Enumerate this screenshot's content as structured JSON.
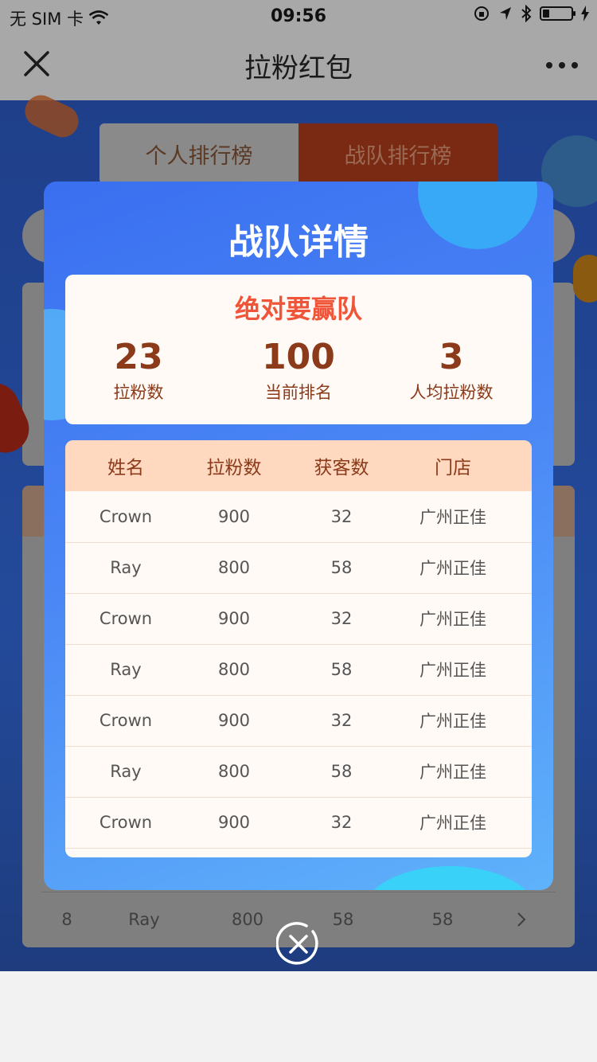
{
  "status_bar": {
    "carrier": "无 SIM 卡",
    "time": "09:56"
  },
  "nav": {
    "title": "拉粉红包"
  },
  "background": {
    "tabs": [
      "个人排行榜",
      "战队排行榜"
    ],
    "last_row": [
      "8",
      "Ray",
      "800",
      "58",
      "58"
    ]
  },
  "modal": {
    "title": "战队详情",
    "team_name": "绝对要赢队",
    "stats": [
      {
        "value": "23",
        "label": "拉粉数"
      },
      {
        "value": "100",
        "label": "当前排名"
      },
      {
        "value": "3",
        "label": "人均拉粉数"
      }
    ],
    "table": {
      "headers": [
        "姓名",
        "拉粉数",
        "获客数",
        "门店"
      ],
      "rows": [
        [
          "Crown",
          "900",
          "32",
          "广州正佳"
        ],
        [
          "Ray",
          "800",
          "58",
          "广州正佳"
        ],
        [
          "Crown",
          "900",
          "32",
          "广州正佳"
        ],
        [
          "Ray",
          "800",
          "58",
          "广州正佳"
        ],
        [
          "Crown",
          "900",
          "32",
          "广州正佳"
        ],
        [
          "Ray",
          "800",
          "58",
          "广州正佳"
        ],
        [
          "Crown",
          "900",
          "32",
          "广州正佳"
        ]
      ]
    }
  },
  "colors": {
    "accent_red": "#f0553a",
    "stat_brown": "#8b3a1a",
    "header_bg": "#fed9c0",
    "modal_blue": "#3a6ff0"
  }
}
